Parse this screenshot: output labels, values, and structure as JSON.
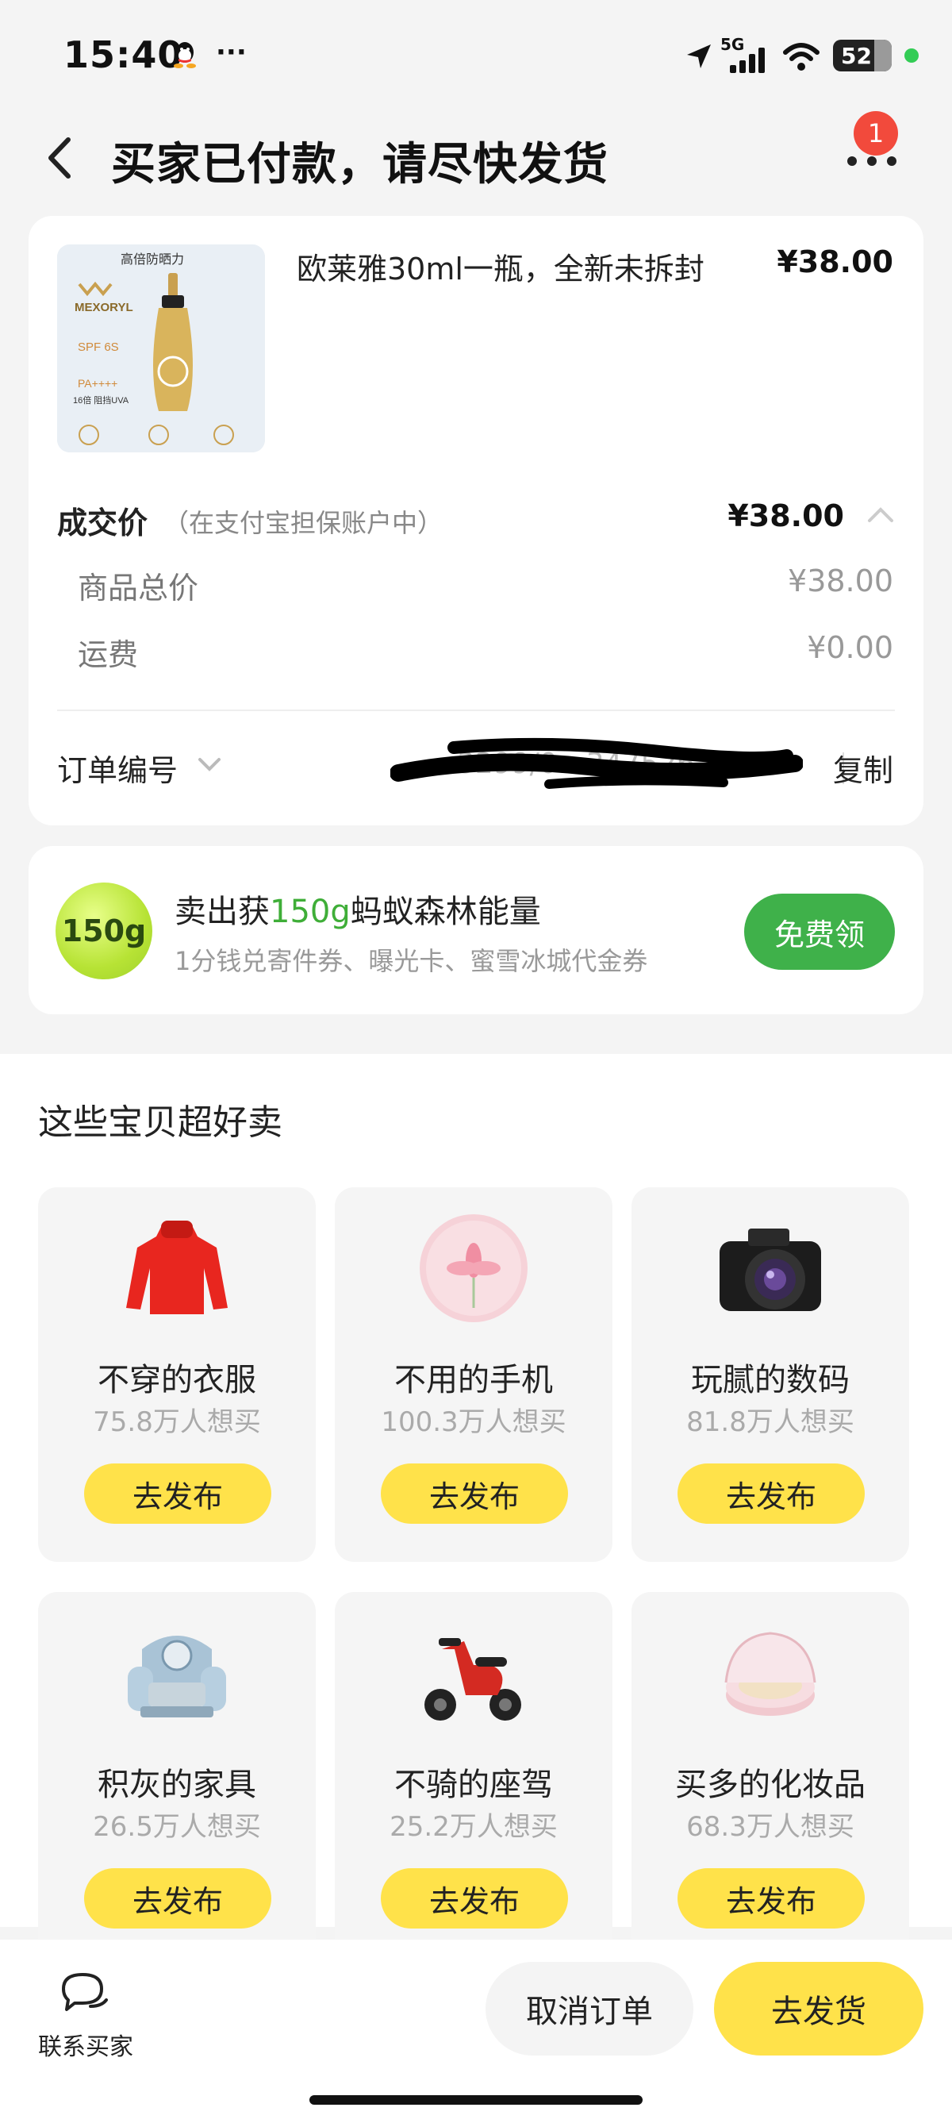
{
  "status_bar": {
    "time": "15:40",
    "more": "···",
    "network": "5G",
    "battery": "52"
  },
  "header": {
    "title": "买家已付款，请尽快发货",
    "badge_count": "1"
  },
  "order": {
    "product_name": "欧莱雅30ml一瓶，全新未拆封",
    "product_price": "¥38.00",
    "product_image_text": {
      "top": "高倍防晒力",
      "brand": "MEXORYL",
      "spf": "SPF 6S",
      "pa": "PA++++",
      "uva": "16倍 阻挡UVA"
    },
    "deal_label": "成交价",
    "deal_note": "（在支付宝担保账户中）",
    "deal_price": "¥38.00",
    "goods_total_label": "商品总价",
    "goods_total_value": "¥38.00",
    "shipping_label": "运费",
    "shipping_value": "¥0.00",
    "order_no_label": "订单编号",
    "order_no_visible": "3299/0…347526…536",
    "copy_label": "复制"
  },
  "energy": {
    "badge": "150g",
    "title_prefix": "卖出获",
    "title_highlight": "150g",
    "title_suffix": "蚂蚁森林能量",
    "subtitle": "1分钱兑寄件券、曝光卡、蜜雪冰城代金券",
    "button": "免费领"
  },
  "recommend": {
    "title": "这些宝贝超好卖",
    "items": [
      {
        "name": "不穿的衣服",
        "want": "75.8万人想买",
        "button": "去发布",
        "icon": "sweater-icon"
      },
      {
        "name": "不用的手机",
        "want": "100.3万人想买",
        "button": "去发布",
        "icon": "phone-flower-icon"
      },
      {
        "name": "玩腻的数码",
        "want": "81.8万人想买",
        "button": "去发布",
        "icon": "camera-icon"
      },
      {
        "name": "积灰的家具",
        "want": "26.5万人想买",
        "button": "去发布",
        "icon": "armchair-icon"
      },
      {
        "name": "不骑的座驾",
        "want": "25.2万人想买",
        "button": "去发布",
        "icon": "scooter-icon"
      },
      {
        "name": "买多的化妆品",
        "want": "68.3万人想买",
        "button": "去发布",
        "icon": "cushion-compact-icon"
      }
    ]
  },
  "bottom_bar": {
    "contact_label": "联系买家",
    "cancel_label": "取消订单",
    "ship_label": "去发货"
  }
}
